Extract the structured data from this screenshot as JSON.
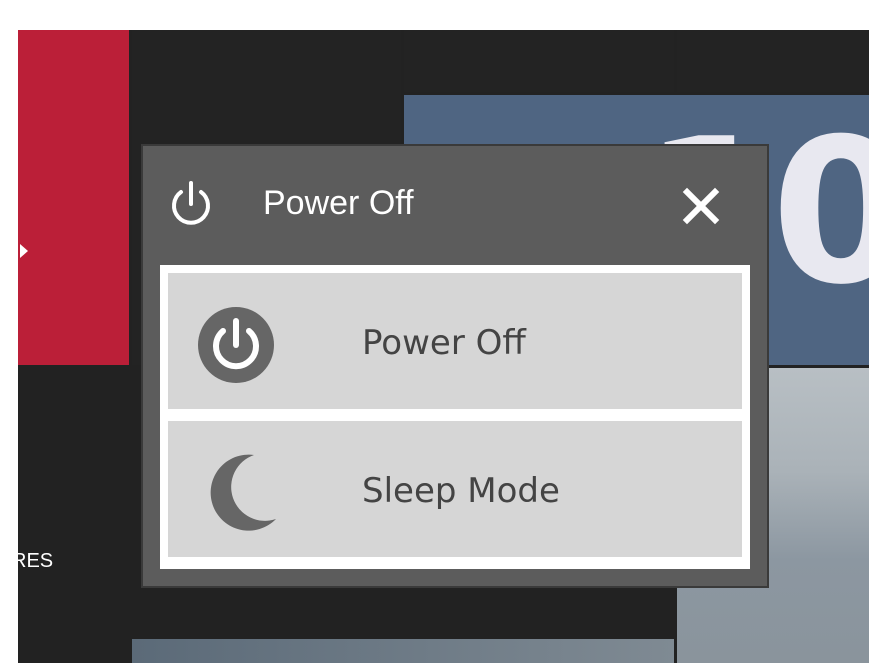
{
  "background": {
    "side_label": "RES"
  },
  "dialog": {
    "title": "Power Off",
    "close_glyph": "✕",
    "items": [
      {
        "label": "Power Off",
        "icon": "power-icon"
      },
      {
        "label": "Sleep Mode",
        "icon": "moon-icon"
      }
    ]
  },
  "colors": {
    "dialog_bg": "#5c5c5c",
    "item_bg": "#d6d6d6",
    "icon_gray": "#666666",
    "accent_red": "#bb1f38",
    "tile_blue": "#4f6582"
  }
}
